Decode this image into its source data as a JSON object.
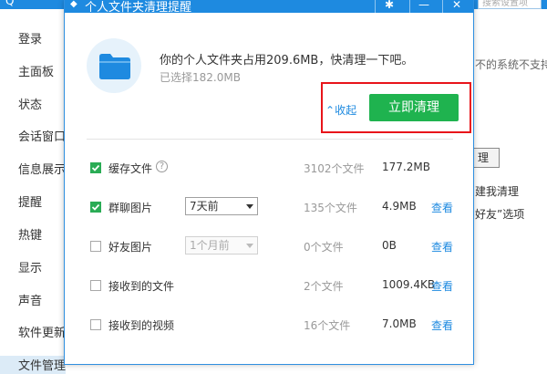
{
  "background": {
    "brand": "Q",
    "search_placeholder": "搜索设置项",
    "sidebar": {
      "items": [
        "登录",
        "主面板",
        "状态",
        "会话窗口",
        "信息展示",
        "提醒",
        "热键",
        "显示",
        "声音",
        "软件更新",
        "文件管理"
      ]
    },
    "right": {
      "line1": "不的系统不支持此",
      "button": "理",
      "line2": "建我清理",
      "line3": "好友”选项"
    }
  },
  "dialog": {
    "title": "个人文件夹清理提醒",
    "headline": "你的个人文件夹占用209.6MB，快清理一下吧。",
    "selected": "已选择182.0MB",
    "collapse_label": "收起",
    "clean_button": "立即清理",
    "rows": [
      {
        "label": "缓存文件",
        "checked": true,
        "count": "3102个文件",
        "size": "177.2MB",
        "view": ""
      },
      {
        "label": "群聊图片",
        "checked": true,
        "dropdown": "7天前",
        "count": "135个文件",
        "size": "4.9MB",
        "view": "查看"
      },
      {
        "label": "好友图片",
        "checked": false,
        "dropdown": "1个月前",
        "count": "0个文件",
        "size": "0B",
        "view": "查看"
      },
      {
        "label": "接收到的文件",
        "checked": false,
        "count": "2个文件",
        "size": "1009.4KB",
        "view": "查看"
      },
      {
        "label": "接收到的视频",
        "checked": false,
        "count": "16个文件",
        "size": "7.0MB",
        "view": "查看"
      }
    ]
  },
  "colors": {
    "accent": "#1e8ae0",
    "clean_button": "#1fb34f",
    "highlight_box": "#e8141a",
    "checkbox_on": "#2aac55"
  }
}
